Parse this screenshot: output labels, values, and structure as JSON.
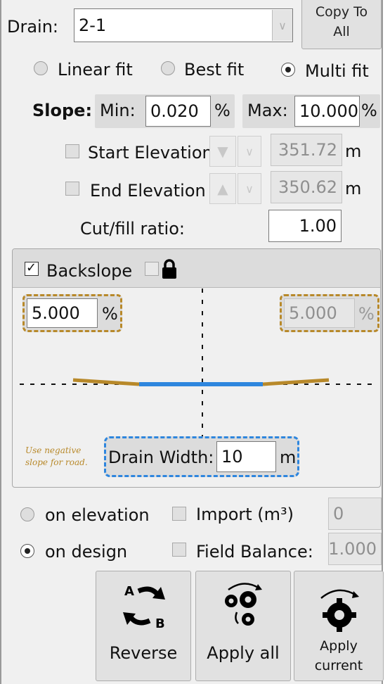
{
  "drain": {
    "label": "Drain:",
    "value": "2-1",
    "copy_to_all": "Copy To\nAll"
  },
  "fit": {
    "linear": "Linear fit",
    "best": "Best fit",
    "multi": "Multi fit",
    "selected": "multi"
  },
  "slope": {
    "label": "Slope:",
    "min_label": "Min:",
    "min_value": "0.020",
    "max_label": "Max:",
    "max_value": "10.000",
    "unit": "%"
  },
  "start_elevation": {
    "label": "Start Elevation",
    "value": "351.72",
    "unit": "m",
    "checked": false
  },
  "end_elevation": {
    "label": "End Elevation",
    "value": "350.62",
    "unit": "m",
    "checked": false
  },
  "cut_fill": {
    "label": "Cut/fill ratio:",
    "value": "1.00"
  },
  "backslope": {
    "label": "Backslope",
    "checked": true,
    "lock_checked": false,
    "left_value": "5.000",
    "right_value": "5.000",
    "unit": "%",
    "note": "Use negative slope for road.",
    "drain_width_label": "Drain Width:",
    "drain_width_value": "10",
    "drain_width_unit": "m"
  },
  "mode": {
    "on_elevation": "on elevation",
    "on_design": "on design",
    "selected": "on_design"
  },
  "import": {
    "label": "Import (m³)",
    "value": "0",
    "checked": false
  },
  "field_balance": {
    "label": "Field Balance:",
    "value": "1.000",
    "checked": false
  },
  "buttons": {
    "reverse": "Reverse",
    "apply_all": "Apply all",
    "apply_current": "Apply\ncurrent",
    "reverse_a": "A",
    "reverse_b": "B"
  },
  "colors": {
    "slope_line": "#b8892a",
    "drain_line": "#2e86de",
    "border": "#9a9a9a"
  }
}
